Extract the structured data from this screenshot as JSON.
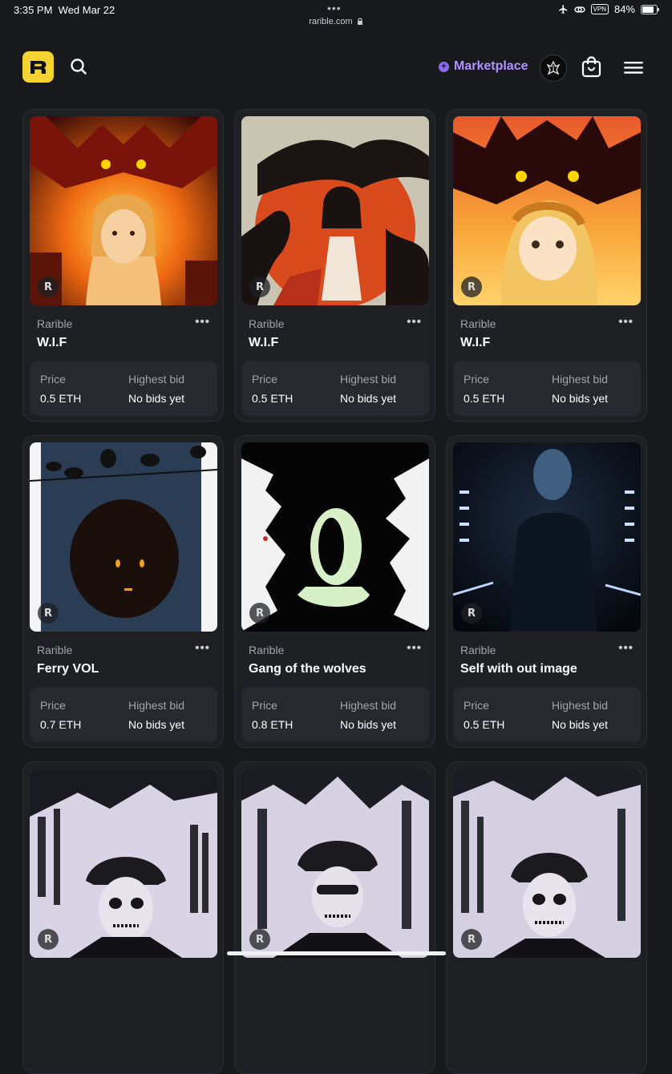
{
  "status_bar": {
    "time": "3:35 PM",
    "date": "Wed Mar 22",
    "dots": "•••",
    "url": "rarible.com",
    "vpn": "VPN",
    "battery": "84%",
    "battery_level": 0.84
  },
  "header": {
    "logo_letter": "R",
    "marketplace_label": "Marketplace",
    "accent_color": "#b394ff",
    "logo_color": "#f5d432"
  },
  "cards": [
    {
      "owner": "Rarible",
      "title": "W.I.F",
      "price_label": "Price",
      "price": "0.5 ETH",
      "bid_label": "Highest bid",
      "bid": "No bids yet",
      "badge": "R"
    },
    {
      "owner": "Rarible",
      "title": "W.I.F",
      "price_label": "Price",
      "price": "0.5 ETH",
      "bid_label": "Highest bid",
      "bid": "No bids yet",
      "badge": "R"
    },
    {
      "owner": "Rarible",
      "title": "W.I.F",
      "price_label": "Price",
      "price": "0.5 ETH",
      "bid_label": "Highest bid",
      "bid": "No bids yet",
      "badge": "R"
    },
    {
      "owner": "Rarible",
      "title": "Ferry VOL",
      "price_label": "Price",
      "price": "0.7 ETH",
      "bid_label": "Highest bid",
      "bid": "No bids yet",
      "badge": "R"
    },
    {
      "owner": "Rarible",
      "title": "Gang of the wolves",
      "price_label": "Price",
      "price": "0.8 ETH",
      "bid_label": "Highest bid",
      "bid": "No bids yet",
      "badge": "R"
    },
    {
      "owner": "Rarible",
      "title": "Self with out image",
      "price_label": "Price",
      "price": "0.5 ETH",
      "bid_label": "Highest bid",
      "bid": "No bids yet",
      "badge": "R"
    },
    {
      "badge": "R"
    },
    {
      "badge": "R"
    },
    {
      "badge": "R"
    }
  ]
}
